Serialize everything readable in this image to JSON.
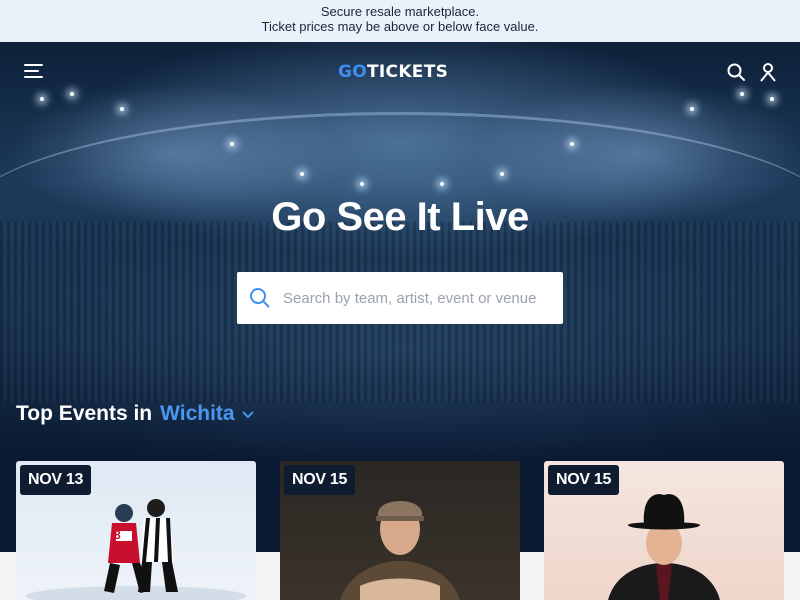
{
  "notice": {
    "line1": "Secure resale marketplace.",
    "line2": "Ticket prices may be above or below face value."
  },
  "nav": {
    "logo_prefix": "GO",
    "logo_suffix": "TICKETS",
    "menu_icon": "hamburger-icon",
    "search_icon": "search-icon",
    "account_icon": "user-icon"
  },
  "hero": {
    "headline": "Go See It Live",
    "search_placeholder": "Search by team, artist, event or venue"
  },
  "top_events": {
    "label": "Top Events in",
    "city": "Wichita",
    "cards": [
      {
        "date": "NOV 13",
        "image": "hockey-players"
      },
      {
        "date": "NOV 15",
        "image": "country-singer-cap"
      },
      {
        "date": "NOV 15",
        "image": "country-singer-cowboy-hat"
      }
    ]
  },
  "colors": {
    "brand_blue": "#3d8ff2",
    "notice_bg": "#e9f2fb",
    "dark_bg": "#0b1a33"
  }
}
